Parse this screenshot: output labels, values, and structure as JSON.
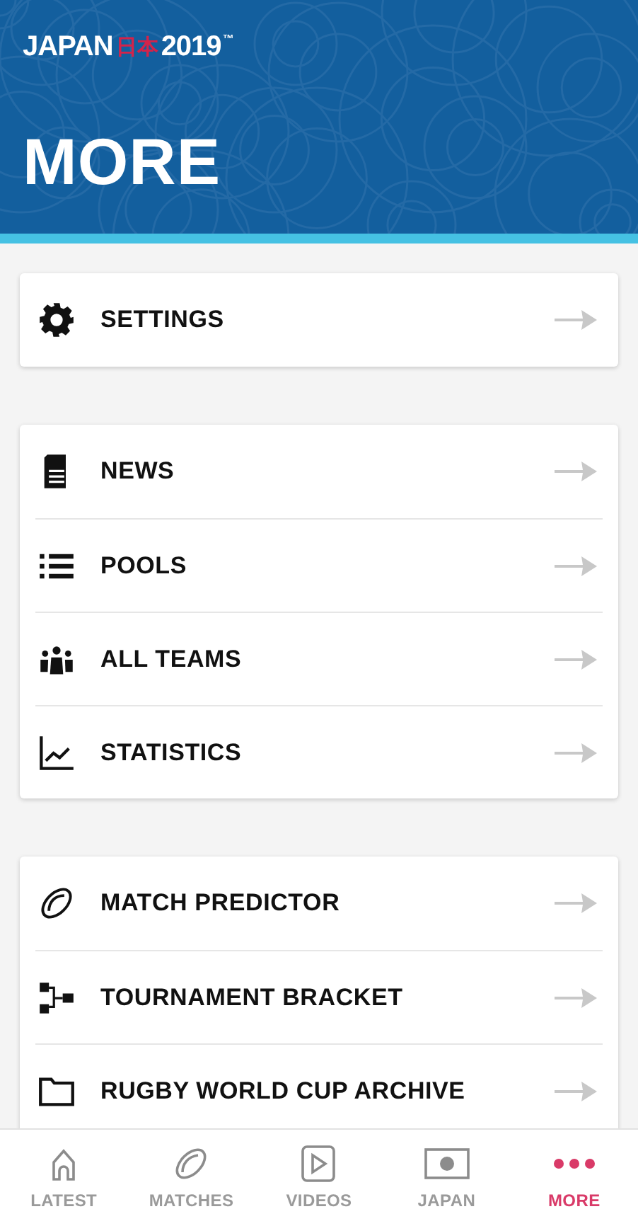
{
  "header": {
    "logo": {
      "word": "JAPAN",
      "kanji": "日本",
      "year": "2019",
      "mark": "™"
    },
    "title": "MORE"
  },
  "sections": [
    {
      "items": [
        {
          "label": "SETTINGS"
        }
      ]
    },
    {
      "items": [
        {
          "label": "NEWS"
        },
        {
          "label": "POOLS"
        },
        {
          "label": "ALL TEAMS"
        },
        {
          "label": "STATISTICS"
        }
      ]
    },
    {
      "items": [
        {
          "label": "MATCH PREDICTOR"
        },
        {
          "label": "TOURNAMENT BRACKET"
        },
        {
          "label": "RUGBY WORLD CUP ARCHIVE"
        }
      ]
    }
  ],
  "tab_bar": [
    {
      "label": "LATEST",
      "selected": false
    },
    {
      "label": "MATCHES",
      "selected": false
    },
    {
      "label": "VIDEOS",
      "selected": false
    },
    {
      "label": "JAPAN",
      "selected": false
    },
    {
      "label": "MORE",
      "selected": true
    }
  ]
}
